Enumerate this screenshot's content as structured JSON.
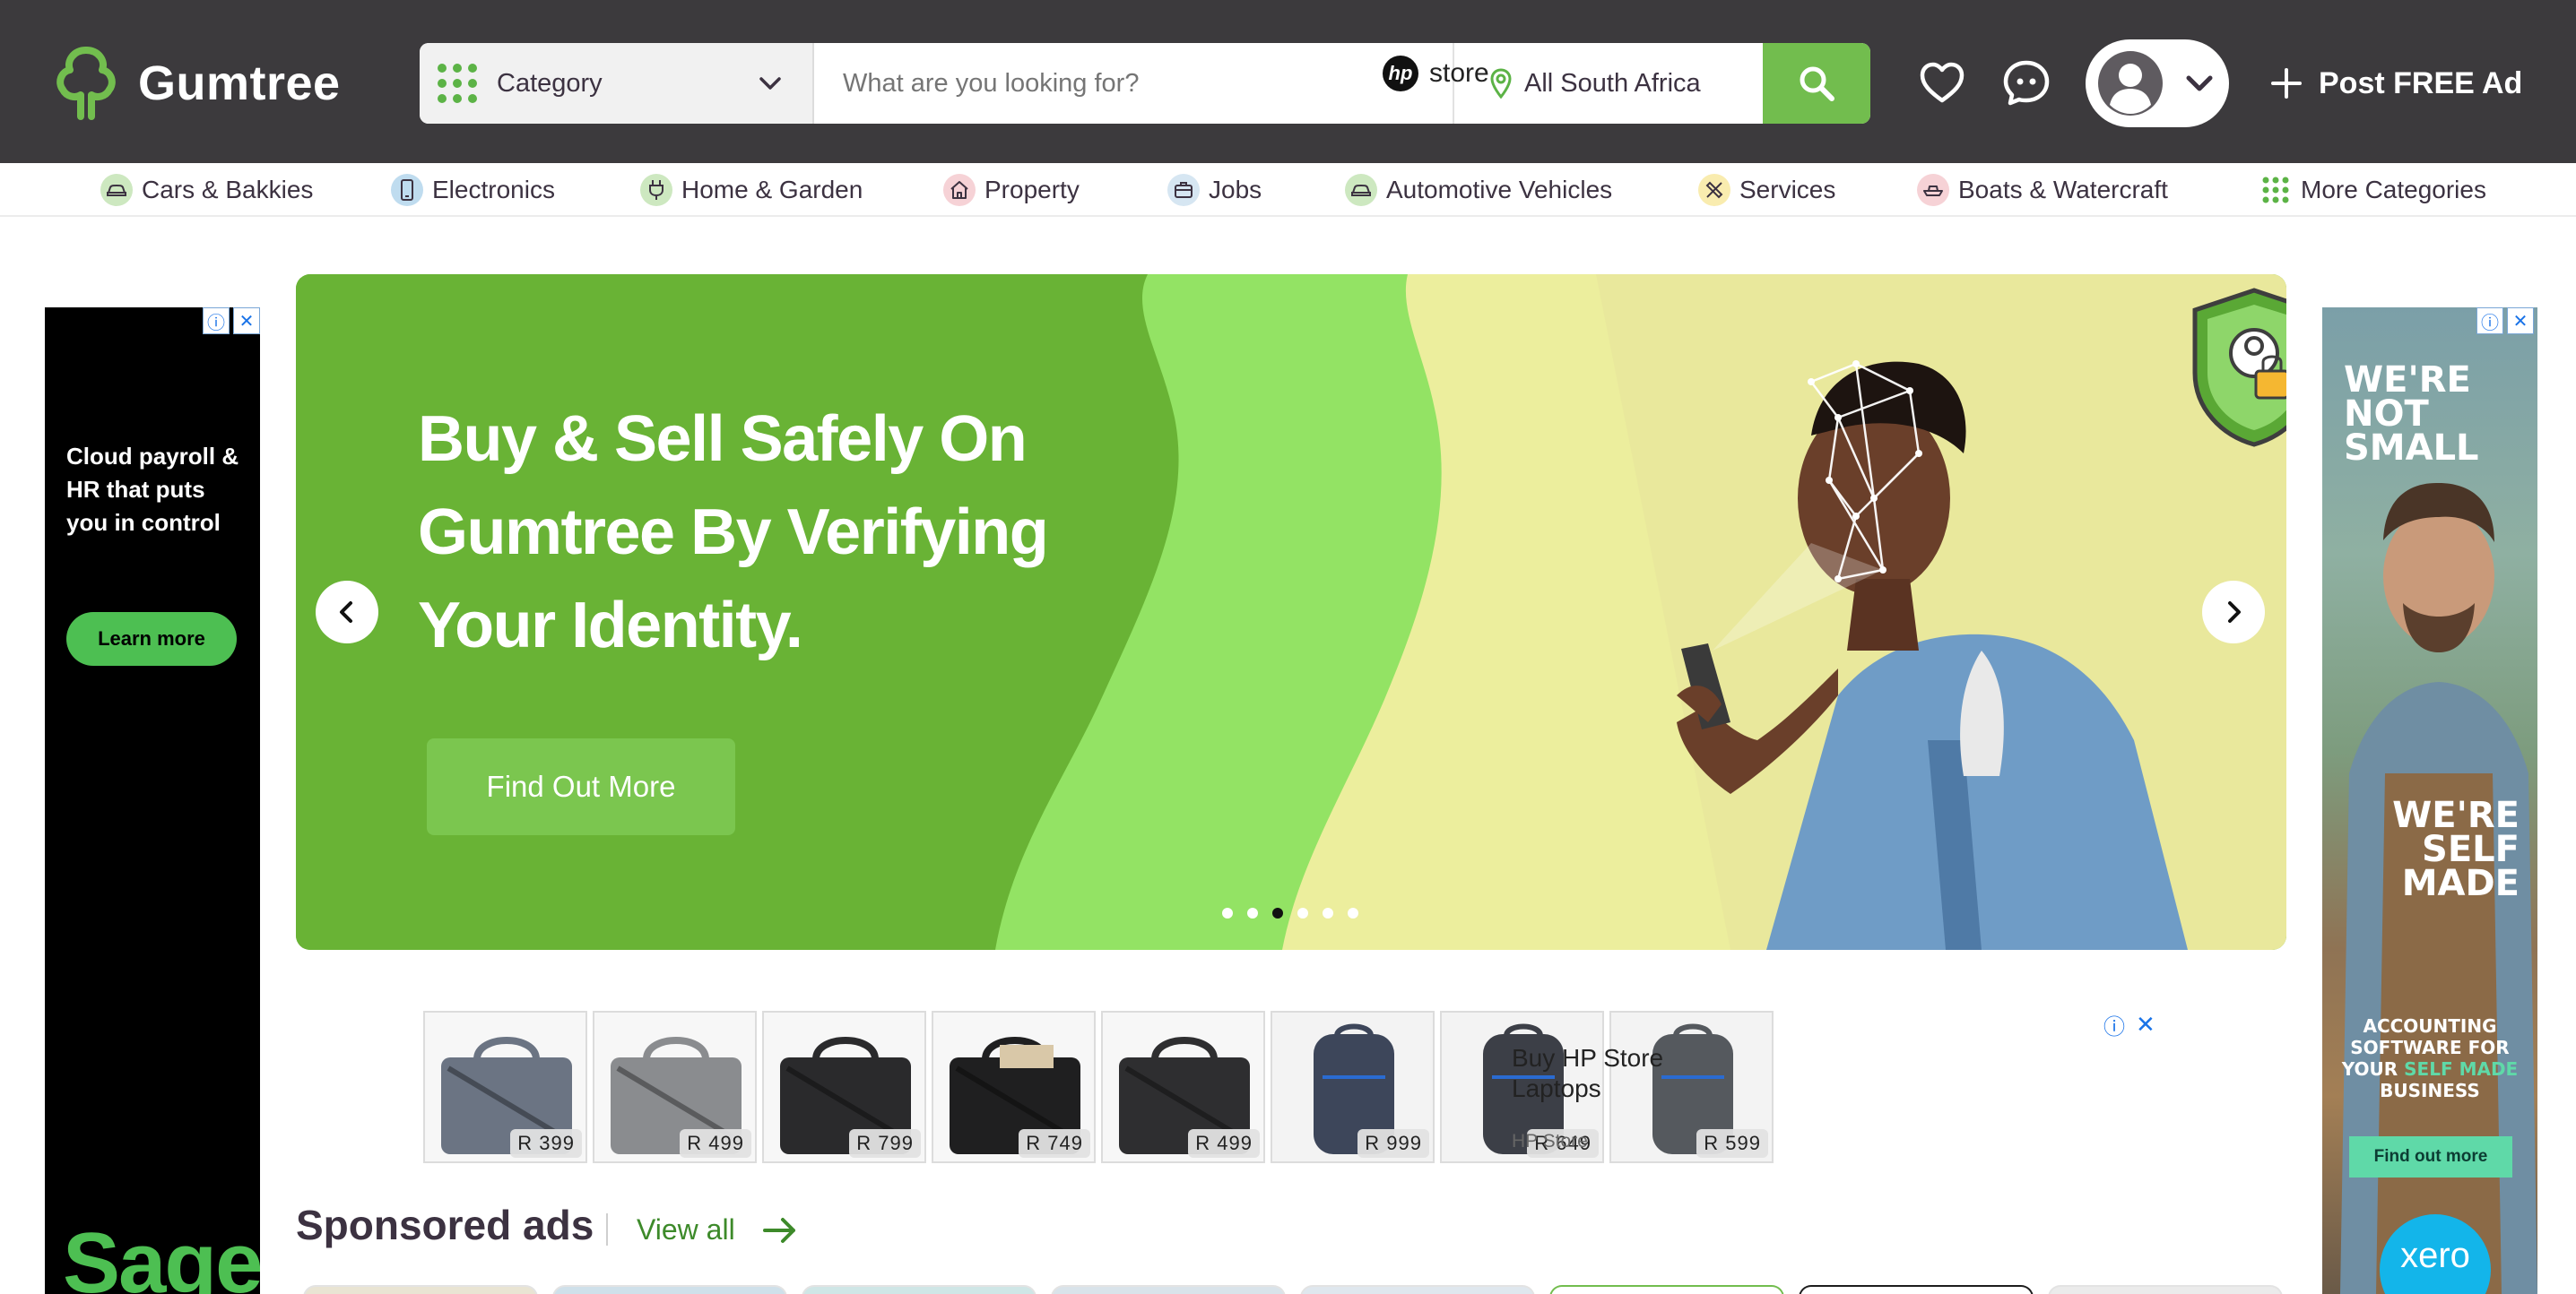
{
  "header": {
    "logo_text": "Gumtree",
    "category_label": "Category",
    "search_placeholder": "What are you looking for?",
    "location": "All South Africa",
    "post_ad_label": "Post FREE Ad"
  },
  "category_nav": [
    {
      "label": "Cars & Bakkies",
      "icon": "car-icon",
      "color": "#cde8c0"
    },
    {
      "label": "Electronics",
      "icon": "phone-icon",
      "color": "#bfdcef"
    },
    {
      "label": "Home & Garden",
      "icon": "plug-icon",
      "color": "#cde8c0"
    },
    {
      "label": "Property",
      "icon": "house-icon",
      "color": "#f6d2d6"
    },
    {
      "label": "Jobs",
      "icon": "briefcase-icon",
      "color": "#d6e6f2"
    },
    {
      "label": "Automotive Vehicles",
      "icon": "car-icon",
      "color": "#cde8c0"
    },
    {
      "label": "Services",
      "icon": "tools-icon",
      "color": "#f9ecaf"
    },
    {
      "label": "Boats & Watercraft",
      "icon": "boat-icon",
      "color": "#f6d2d6"
    },
    {
      "label": "More Categories",
      "icon": "grid-icon",
      "color": "#ffffff"
    }
  ],
  "left_ad": {
    "headline": "Cloud payroll & HR that puts you in control",
    "button": "Learn more",
    "brand": "Sage"
  },
  "right_ad": {
    "line1": "WE'RE NOT SMALL",
    "line2": "WE'RE SELF MADE",
    "body_pre": "ACCOUNTING SOFTWARE FOR YOUR ",
    "body_accent": "SELF MADE",
    "body_post": " BUSINESS",
    "button": "Find out more",
    "brand": "xero"
  },
  "hero": {
    "title": "Buy & Sell Safely On Gumtree By Verifying Your Identity.",
    "cta": "Find Out More",
    "slide_count": 6,
    "active_slide": 3
  },
  "hp_ad": {
    "products": [
      {
        "price": "R 399",
        "kind": "grey-messenger"
      },
      {
        "price": "R 499",
        "kind": "grey-bag"
      },
      {
        "price": "R 799",
        "kind": "black-bag"
      },
      {
        "price": "R 749",
        "kind": "black-bag-tag"
      },
      {
        "price": "R 499",
        "kind": "black-messenger"
      },
      {
        "price": "R 999",
        "kind": "navy-backpack"
      },
      {
        "price": "R 649",
        "kind": "dark-backpack"
      },
      {
        "price": "R 599",
        "kind": "grey-backpack"
      }
    ],
    "brand_logo": "hp",
    "brand_store": "store",
    "title": "Buy HP Store Laptops",
    "advertiser": "HP Store"
  },
  "sponsored": {
    "title": "Sponsored ads",
    "view_all": "View all"
  },
  "colors": {
    "header_bg": "#3c3a3d",
    "brand_green": "#72bd4e",
    "hero_green": "#69b335",
    "link_green": "#3d8a2a"
  }
}
